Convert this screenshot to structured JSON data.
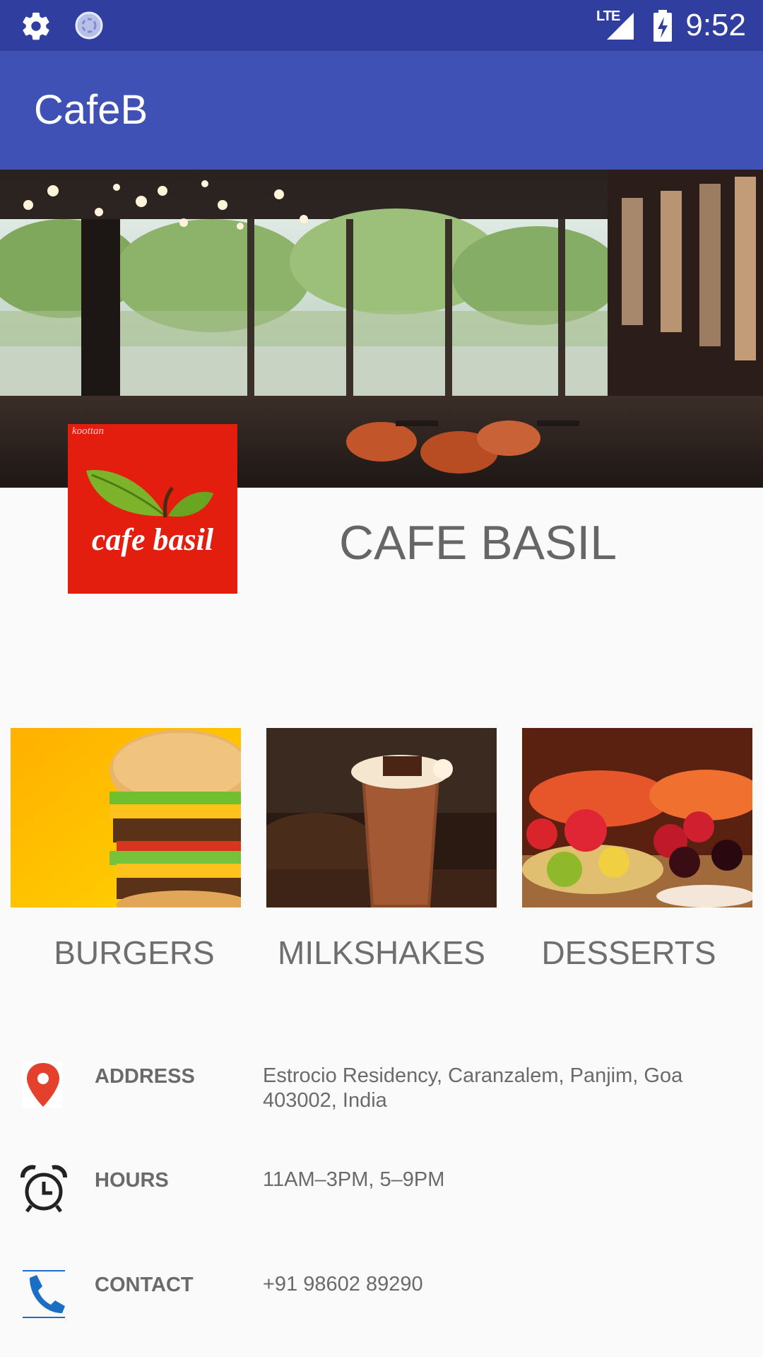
{
  "status_bar": {
    "network": "LTE",
    "time": "9:52",
    "icons": [
      "settings-icon",
      "sync-icon",
      "signal-icon",
      "battery-charging-icon"
    ]
  },
  "app_bar": {
    "title": "CafeB"
  },
  "hero": {
    "image": "cafe-interior-photo"
  },
  "logo": {
    "small_text": "koottan",
    "name": "cafe basil"
  },
  "cafe": {
    "name": "CAFE BASIL"
  },
  "categories": [
    {
      "label": "BURGERS",
      "image": "burger-photo"
    },
    {
      "label": "MILKSHAKES",
      "image": "milkshake-photo"
    },
    {
      "label": "DESSERTS",
      "image": "desserts-photo"
    }
  ],
  "info": [
    {
      "key": "ADDRESS",
      "value": "Estrocio Residency, Caranzalem, Panjim, Goa 403002, India",
      "icon": "location-pin-icon"
    },
    {
      "key": "HOURS",
      "value": "11AM–3PM, 5–9PM",
      "icon": "alarm-clock-icon"
    },
    {
      "key": "CONTACT",
      "value": "+91 98602 89290",
      "icon": "phone-icon"
    }
  ],
  "colors": {
    "primary": "#3f51b5",
    "primary_dark": "#303f9f",
    "logo_red": "#e31e0f",
    "text_gray": "#6e6e6e"
  }
}
